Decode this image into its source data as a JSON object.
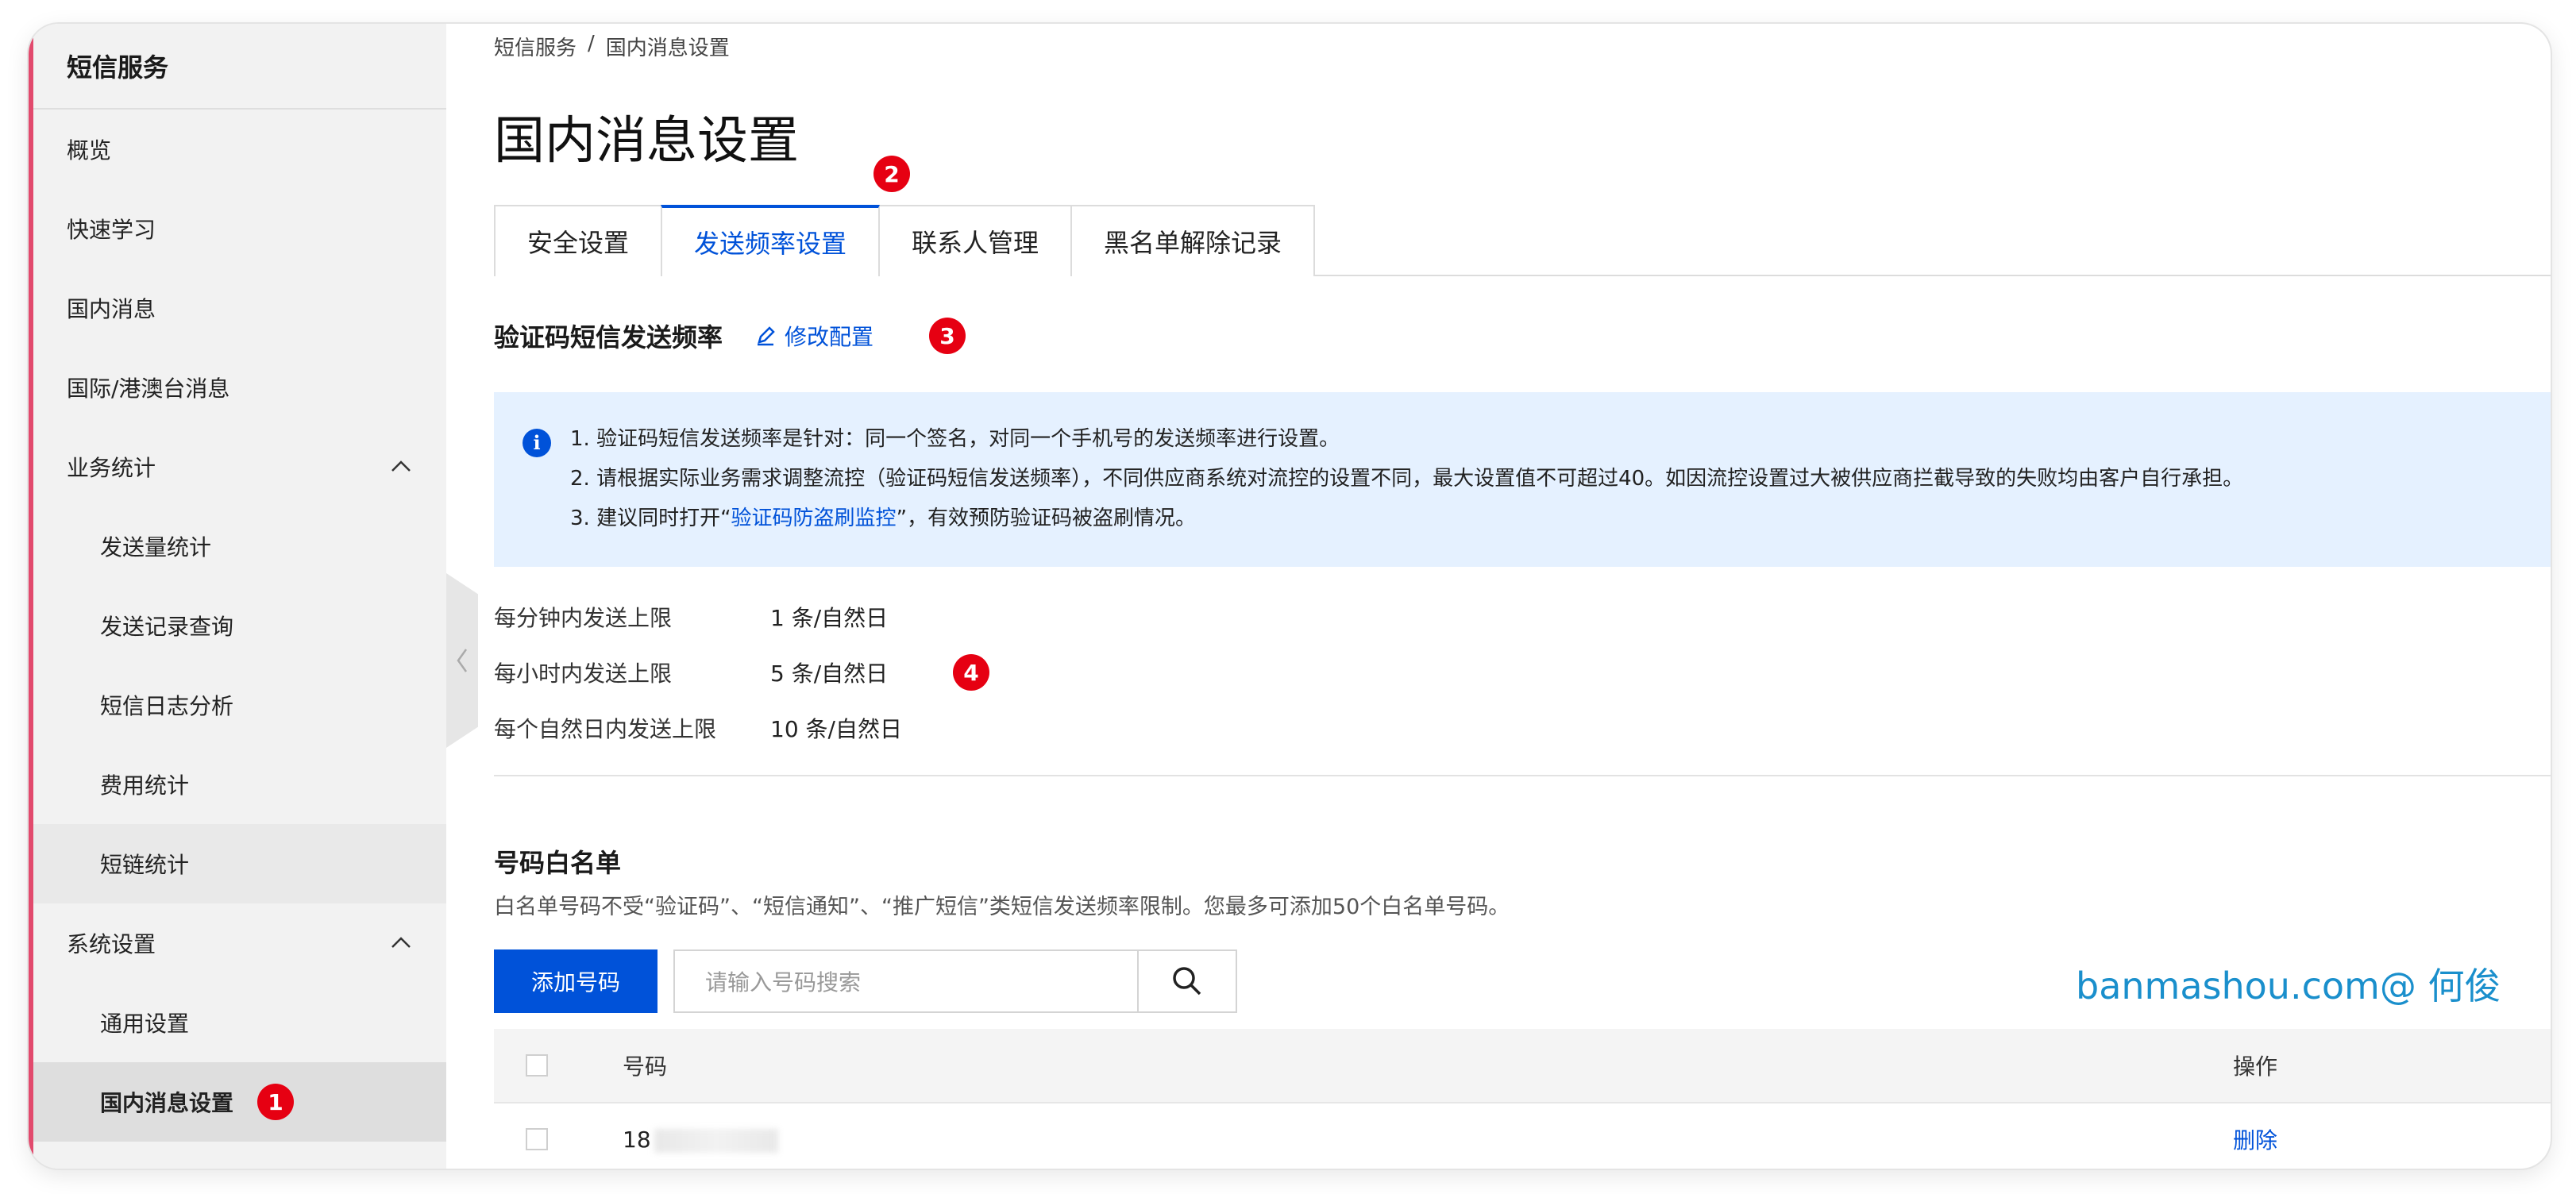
{
  "sidebar": {
    "title": "短信服务",
    "items": [
      {
        "label": "概览"
      },
      {
        "label": "快速学习"
      },
      {
        "label": "国内消息"
      },
      {
        "label": "国际/港澳台消息"
      },
      {
        "label": "业务统计"
      },
      {
        "label": "发送量统计"
      },
      {
        "label": "发送记录查询"
      },
      {
        "label": "短信日志分析"
      },
      {
        "label": "费用统计"
      },
      {
        "label": "短链统计"
      },
      {
        "label": "系统设置"
      },
      {
        "label": "通用设置"
      },
      {
        "label": "国内消息设置"
      }
    ]
  },
  "badges": {
    "b1": "1",
    "b2": "2",
    "b3": "3",
    "b4": "4"
  },
  "breadcrumb": {
    "root": "短信服务",
    "sep": "/",
    "current": "国内消息设置"
  },
  "page_title": "国内消息设置",
  "tabs": [
    {
      "label": "安全设置"
    },
    {
      "label": "发送频率设置"
    },
    {
      "label": "联系人管理"
    },
    {
      "label": "黑名单解除记录"
    }
  ],
  "section": {
    "title": "验证码短信发送频率",
    "edit_label": "修改配置"
  },
  "notice": {
    "info_icon": "i",
    "line1": "1. 验证码短信发送频率是针对：同一个签名，对同一个手机号的发送频率进行设置。",
    "line2": "2. 请根据实际业务需求调整流控（验证码短信发送频率），不同供应商系统对流控的设置不同，最大设置值不可超过40。如因流控设置过大被供应商拦截导致的失败均由客户自行承担。",
    "line3_pre": "3. 建议同时打开“",
    "line3_link": "验证码防盗刷监控",
    "line3_post": "”，有效预防验证码被盗刷情况。"
  },
  "limits": [
    {
      "label": "每分钟内发送上限",
      "value": "1 条/自然日"
    },
    {
      "label": "每小时内发送上限",
      "value": "5 条/自然日"
    },
    {
      "label": "每个自然日内发送上限",
      "value": "10 条/自然日"
    }
  ],
  "whitelist": {
    "title": "号码白名单",
    "desc": "白名单号码不受“验证码”、“短信通知”、“推广短信”类短信发送频率限制。您最多可添加50个白名单号码。",
    "add_button": "添加号码",
    "search_placeholder": "请输入号码搜索",
    "col_number": "号码",
    "col_action": "操作",
    "rows": [
      {
        "number": "18",
        "action": "删除"
      }
    ]
  },
  "watermark": "banmashou.com@ 何俊",
  "colors": {
    "accent": "#0052d9",
    "badge": "#e60012",
    "notice_bg": "#e5f1ff"
  }
}
